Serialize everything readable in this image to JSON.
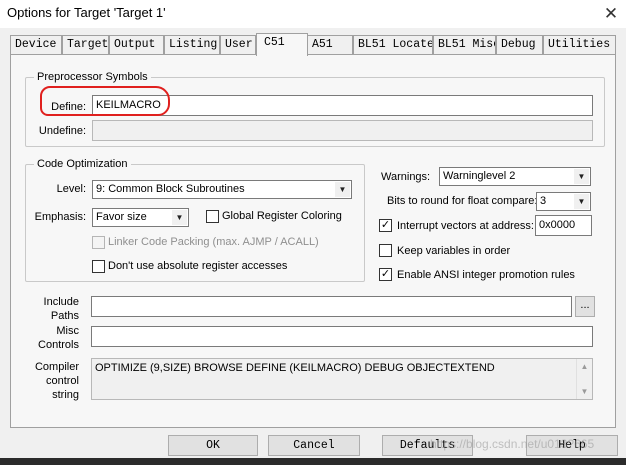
{
  "window": {
    "title": "Options for Target 'Target 1'",
    "close_symbol": "✕"
  },
  "tabs": [
    {
      "label": "Device",
      "active": false
    },
    {
      "label": "Target",
      "active": false
    },
    {
      "label": "Output",
      "active": false
    },
    {
      "label": "Listing",
      "active": false
    },
    {
      "label": "User",
      "active": false
    },
    {
      "label": "C51",
      "active": true
    },
    {
      "label": "A51",
      "active": false
    },
    {
      "label": "BL51 Locate",
      "active": false
    },
    {
      "label": "BL51 Misc",
      "active": false
    },
    {
      "label": "Debug",
      "active": false
    },
    {
      "label": "Utilities",
      "active": false
    }
  ],
  "preprocessor": {
    "legend": "Preprocessor Symbols",
    "define_label": "Define:",
    "define_value": "KEILMACRO",
    "undefine_label": "Undefine:",
    "undefine_value": ""
  },
  "optimization": {
    "legend": "Code Optimization",
    "level_label": "Level:",
    "level_value": "9: Common Block Subroutines",
    "emphasis_label": "Emphasis:",
    "emphasis_value": "Favor size",
    "global_register_label": "Global Register Coloring",
    "global_register_checked": false,
    "linker_packing_label": "Linker Code Packing (max. AJMP / ACALL)",
    "linker_packing_checked": false,
    "absolute_register_label": "Don't use absolute register accesses",
    "absolute_register_checked": false
  },
  "options": {
    "warnings_label": "Warnings:",
    "warnings_value": "Warninglevel 2",
    "float_label": "Bits to round for float compare:",
    "float_value": "3",
    "interrupt_label": "Interrupt vectors at address:",
    "interrupt_checked": true,
    "interrupt_value": "0x0000",
    "keep_vars_label": "Keep variables in order",
    "keep_vars_checked": false,
    "ansi_label": "Enable ANSI integer promotion rules",
    "ansi_checked": true
  },
  "paths": {
    "include_label_1": "Include",
    "include_label_2": "Paths",
    "include_value": "",
    "browse_label": "...",
    "misc_label_1": "Misc",
    "misc_label_2": "Controls",
    "misc_value": "",
    "compiler_label_1": "Compiler",
    "compiler_label_2": "control",
    "compiler_label_3": "string",
    "compiler_value": "OPTIMIZE (9,SIZE) BROWSE DEFINE (KEILMACRO) DEBUG OBJECTEXTEND"
  },
  "buttons": {
    "ok": "OK",
    "cancel": "Cancel",
    "defaults": "Defaults",
    "help": "Help"
  },
  "watermark": "https://blog.csdn.net/u013?665",
  "symbols": {
    "check": "✓",
    "dropdown": "▼",
    "scroll_up": "▲",
    "scroll_down": "▼"
  },
  "colors": {
    "annotation": "#e0201e",
    "panel": "#f7f7f7"
  }
}
